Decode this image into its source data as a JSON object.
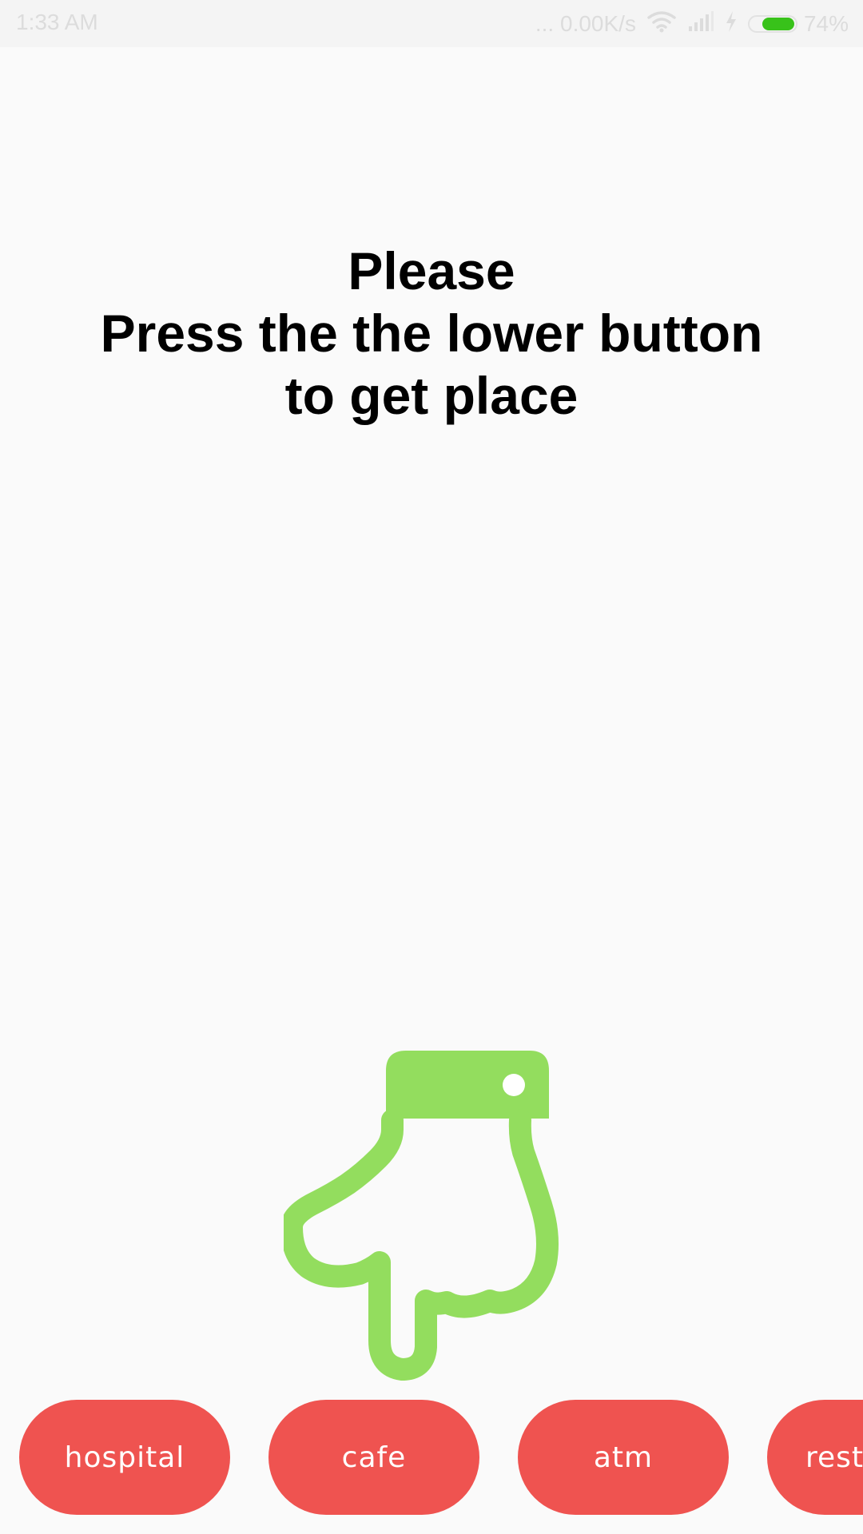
{
  "status_bar": {
    "time": "1:33 AM",
    "net_speed": "... 0.00K/s",
    "battery_percent": "74%",
    "battery_level": 0.74,
    "battery_color": "#38c21a",
    "icons": [
      "wifi-icon",
      "signal-icon",
      "charging-icon",
      "battery-icon"
    ]
  },
  "instruction": {
    "line1": "Please",
    "line2": "Press the the lower button",
    "line3": "to get place"
  },
  "hand_icon": {
    "name": "pointing-down-hand-icon",
    "color": "#93dd5e"
  },
  "buttons": {
    "color": "#ef5350",
    "items": [
      {
        "label": "hospital"
      },
      {
        "label": "cafe"
      },
      {
        "label": "atm"
      },
      {
        "label": "resta"
      }
    ]
  }
}
